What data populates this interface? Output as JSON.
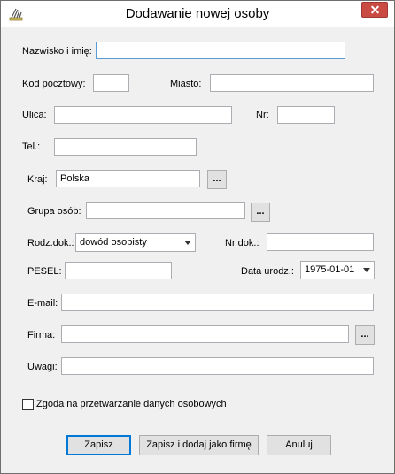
{
  "window": {
    "title": "Dodawanie nowej osoby"
  },
  "form": {
    "name_label": "Nazwisko i imię:",
    "name_value": "",
    "postcode_label": "Kod pocztowy:",
    "postcode_value": "",
    "city_label": "Miasto:",
    "city_value": "",
    "street_label": "Ulica:",
    "street_value": "",
    "number_label": "Nr:",
    "number_value": "",
    "phone_label": "Tel.:",
    "phone_value": "",
    "country_label": "Kraj:",
    "country_value": "Polska",
    "group_label": "Grupa osób:",
    "group_value": "",
    "doctype_label": "Rodz.dok.:",
    "doctype_value": "dowód osobisty",
    "docnum_label": "Nr dok.:",
    "docnum_value": "",
    "pesel_label": "PESEL:",
    "pesel_value": "",
    "birthdate_label": "Data urodz.:",
    "birthdate_value": "1975-01-01",
    "email_label": "E-mail:",
    "email_value": "",
    "company_label": "Firma:",
    "company_value": "",
    "notes_label": "Uwagi:",
    "notes_value": "",
    "browse_label": "...",
    "consent_label": "Zgoda na przetwarzanie danych osobowych",
    "consent_checked": false
  },
  "buttons": {
    "save": "Zapisz",
    "save_add_company": "Zapisz i dodaj jako firmę",
    "cancel": "Anuluj"
  }
}
